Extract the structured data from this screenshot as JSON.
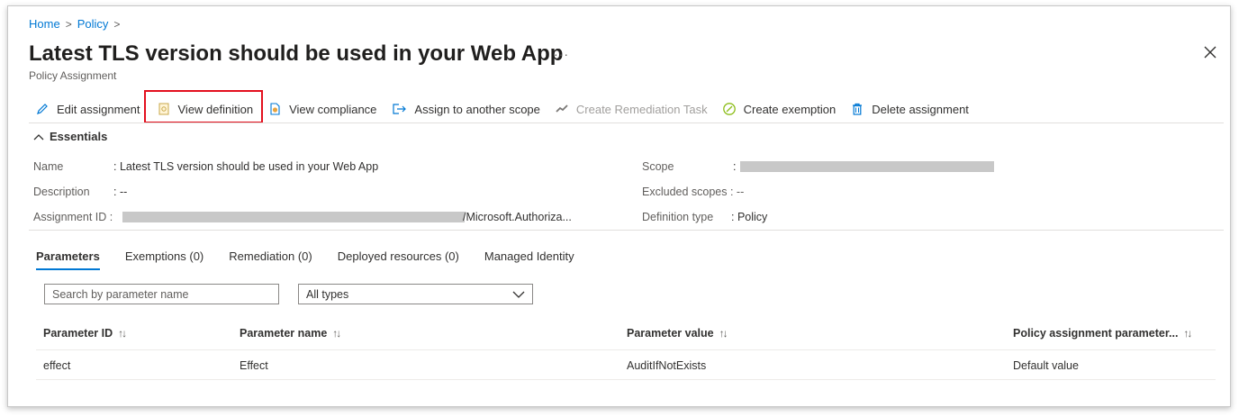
{
  "breadcrumb": {
    "home": "Home",
    "policy": "Policy"
  },
  "header": {
    "title": "Latest TLS version should be used in your Web App",
    "subtitle": "Policy Assignment",
    "more": "···"
  },
  "toolbar": {
    "edit": "Edit assignment",
    "view_definition": "View definition",
    "view_compliance": "View compliance",
    "assign_scope": "Assign to another scope",
    "create_remediation": "Create Remediation Task",
    "create_exemption": "Create exemption",
    "delete": "Delete assignment"
  },
  "essentials": {
    "heading": "Essentials",
    "name_label": "Name",
    "name_value": ": Latest TLS version should be used in your Web App",
    "description_label": "Description",
    "description_value": ": --",
    "assignment_id_label": "Assignment ID :",
    "assignment_id_suffix": "/Microsoft.Authoriza...",
    "scope_label": "Scope",
    "scope_sep": ":",
    "excluded_label": "Excluded scopes : --",
    "definition_type_label": "Definition type",
    "definition_type_value": ": Policy"
  },
  "tabs": [
    {
      "label": "Parameters"
    },
    {
      "label": "Exemptions (0)"
    },
    {
      "label": "Remediation (0)"
    },
    {
      "label": "Deployed resources (0)"
    },
    {
      "label": "Managed Identity"
    }
  ],
  "filters": {
    "search_placeholder": "Search by parameter name",
    "type_selected": "All types"
  },
  "table": {
    "columns": [
      "Parameter ID",
      "Parameter name",
      "Parameter value",
      "Policy assignment parameter..."
    ],
    "sort_glyph": "↑↓",
    "rows": [
      [
        "effect",
        "Effect",
        "AuditIfNotExists",
        "Default value"
      ]
    ]
  },
  "colors": {
    "accent": "#0078d4",
    "highlight": "#e3101e",
    "disabled": "#a19f9d"
  }
}
